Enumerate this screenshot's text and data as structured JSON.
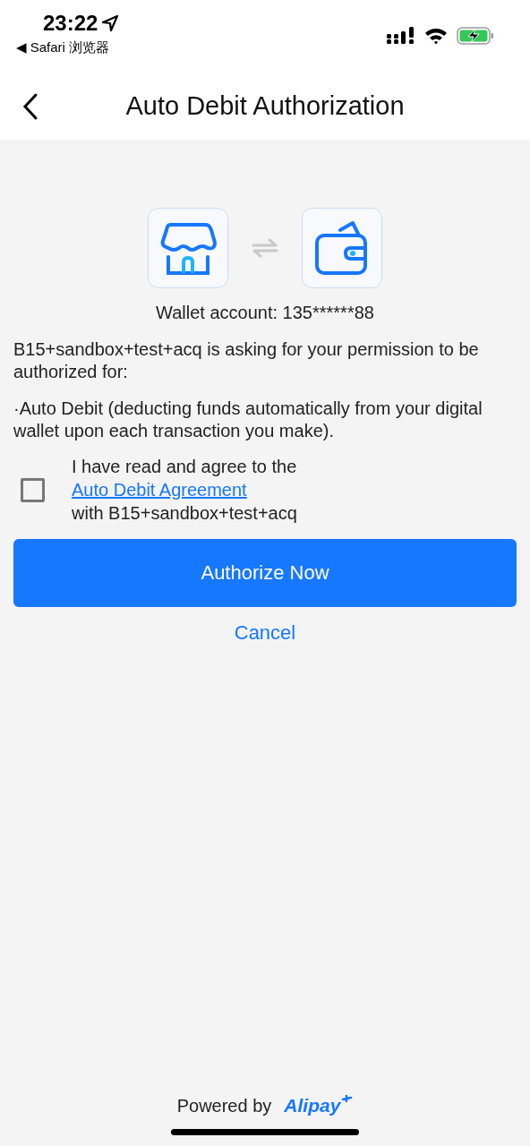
{
  "status_bar": {
    "time": "23:22",
    "back_app": "◀ Safari 浏览器"
  },
  "header": {
    "title": "Auto Debit Authorization"
  },
  "account": "Wallet account: 135******88",
  "request": "B15+sandbox+test+acq is asking for your permission to be authorized for:",
  "scope": "·Auto Debit (deducting funds automatically from your digital wallet upon each transaction you make).",
  "agreement": {
    "checked": false,
    "before": "I have read and agree to the",
    "link": "Auto Debit Agreement",
    "after": "with B15+sandbox+test+acq"
  },
  "primary_button": "Authorize Now",
  "cancel_link": "Cancel",
  "footer": {
    "powered_by": "Powered by",
    "brand": "Alipay"
  }
}
